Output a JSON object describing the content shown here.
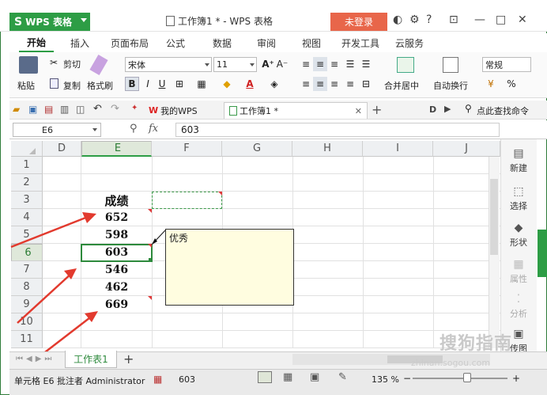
{
  "app": {
    "name": "WPS 表格",
    "doc_title": "工作簿1 * - WPS 表格",
    "login_label": "未登录"
  },
  "window": {
    "help": "?",
    "minimize": "—",
    "maximize": "□",
    "close": "✕"
  },
  "tabs": [
    "开始",
    "插入",
    "页面布局",
    "公式",
    "数据",
    "审阅",
    "视图",
    "开发工具",
    "云服务"
  ],
  "ribbon": {
    "paste": "粘贴",
    "cut": "剪切",
    "copy": "复制",
    "format_painter": "格式刷",
    "font_name": "宋体",
    "font_size": "11",
    "bold": "B",
    "italic": "I",
    "underline": "U",
    "merge": "合并居中",
    "wrap": "自动换行",
    "number_format": "常规",
    "percent": "%"
  },
  "doc_tabs": {
    "wps": "我的WPS",
    "book": "工作簿1 *",
    "add": "+",
    "search": "点此查找命令"
  },
  "formula_bar": {
    "name_box": "E6",
    "fx": "fx",
    "value": "603"
  },
  "columns": [
    "D",
    "E",
    "F",
    "G",
    "H",
    "I",
    "J"
  ],
  "rows": [
    "1",
    "2",
    "3",
    "4",
    "5",
    "6",
    "7",
    "8",
    "9",
    "10",
    "11"
  ],
  "cells": {
    "header": "成绩",
    "values": [
      "652",
      "598",
      "603",
      "546",
      "462",
      "669"
    ]
  },
  "comment": {
    "text": "优秀"
  },
  "sidebar": [
    "新建",
    "选择",
    "形状",
    "属性",
    "分析",
    "传图"
  ],
  "sheet_tab": {
    "name": "工作表1",
    "add": "+"
  },
  "status": {
    "cell_info": "单元格 E6 批注者 Administrator",
    "value": "603",
    "zoom": "135 %"
  },
  "watermark": {
    "text": "搜狗指南",
    "url": "zhinan.sogou.com"
  }
}
